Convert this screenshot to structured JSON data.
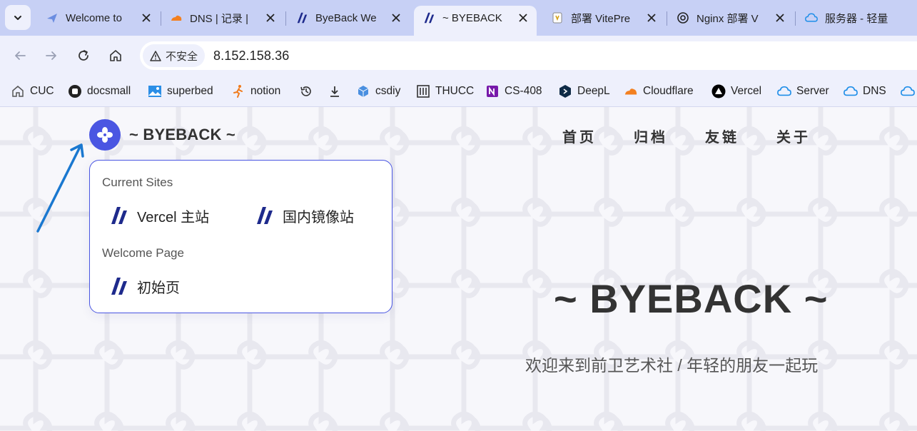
{
  "browser": {
    "tabs": [
      {
        "title": "Welcome to",
        "favicon": "plane-icon",
        "active": false
      },
      {
        "title": "DNS | 记录 |",
        "favicon": "cloudflare-icon",
        "active": false
      },
      {
        "title": "ByeBack We",
        "favicon": "byeback-icon",
        "active": false
      },
      {
        "title": "~ BYEBACK",
        "favicon": "byeback-icon",
        "active": true
      },
      {
        "title": "部署 VitePre",
        "favicon": "doc-icon",
        "active": false
      },
      {
        "title": "Nginx 部署 V",
        "favicon": "openai-icon",
        "active": false
      },
      {
        "title": "服务器 - 轻量",
        "favicon": "cloud-icon",
        "active": false
      }
    ],
    "security_label": "不安全",
    "url": "8.152.158.36",
    "bookmarks": [
      {
        "label": "CUC",
        "icon": "home-icon"
      },
      {
        "label": "docsmall",
        "icon": "circle-icon"
      },
      {
        "label": "superbed",
        "icon": "image-icon"
      },
      {
        "label": "notion",
        "icon": "runner-icon"
      },
      {
        "label": "",
        "icon": "history-icon"
      },
      {
        "label": "",
        "icon": "download-icon"
      },
      {
        "label": "csdiy",
        "icon": "cube-icon"
      },
      {
        "label": "THUCC",
        "icon": "building-icon"
      },
      {
        "label": "CS-408",
        "icon": "onenote-icon"
      },
      {
        "label": "DeepL",
        "icon": "deepl-icon"
      },
      {
        "label": "Cloudflare",
        "icon": "cloudflare-icon"
      },
      {
        "label": "Vercel",
        "icon": "vercel-icon"
      },
      {
        "label": "Server",
        "icon": "cloud-icon"
      },
      {
        "label": "DNS",
        "icon": "cloud-icon"
      },
      {
        "label": "",
        "icon": "cloud-icon"
      }
    ]
  },
  "site": {
    "title": "~ BYEBACK ~",
    "nav": [
      "首页",
      "归档",
      "友链",
      "关于"
    ],
    "dropdown": {
      "groups": [
        {
          "label": "Current Sites",
          "items": [
            "Vercel 主站",
            "国内镜像站"
          ]
        },
        {
          "label": "Welcome Page",
          "items": [
            "初始页"
          ]
        }
      ]
    },
    "hero_title": "~ BYEBACK ~",
    "hero_subtitle": "欢迎来到前卫艺术社 / 年轻的朋友一起玩"
  },
  "colors": {
    "accent": "#4a56e2",
    "byeback_logo": "#1e2a8c",
    "annotation_arrow": "#1a78d0"
  }
}
